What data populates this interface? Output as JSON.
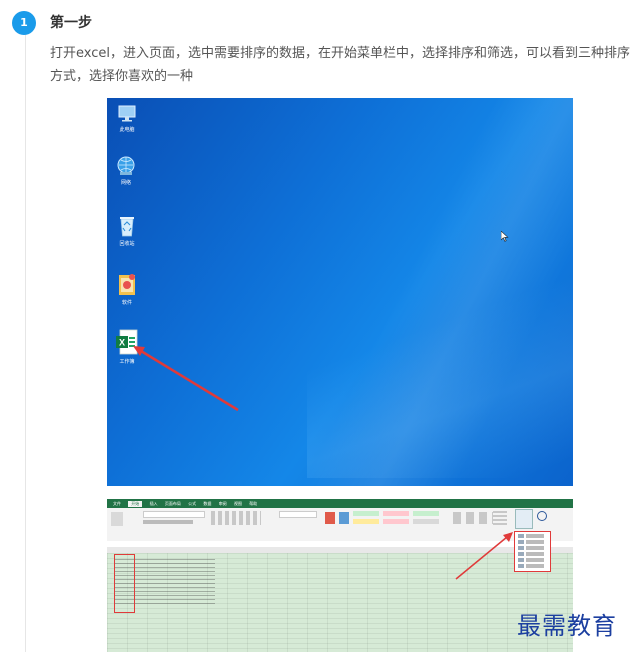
{
  "step": {
    "number": "1",
    "title": "第一步",
    "description": "打开excel，进入页面，选中需要排序的数据，在开始菜单栏中，选择排序和筛选，可以看到三种排序方式，选择你喜欢的一种"
  },
  "desktop": {
    "icons": [
      {
        "name": "this-pc-icon",
        "label": "此电脑"
      },
      {
        "name": "network-icon",
        "label": "网络"
      },
      {
        "name": "recycle-bin-icon",
        "label": "回收站"
      },
      {
        "name": "folder-icon",
        "label": "软件"
      },
      {
        "name": "excel-file-icon",
        "label": "工作簿"
      }
    ]
  },
  "excel": {
    "tabs": [
      "文件",
      "开始",
      "插入",
      "页面布局",
      "公式",
      "数据",
      "审阅",
      "视图",
      "帮助"
    ]
  },
  "watermark": "最需教育",
  "colors": {
    "badge": "#1a9bea",
    "desktop_blue": "#0e6fd6",
    "excel_green": "#217346",
    "arrow_red": "#e03a3a",
    "watermark": "#1c3fa0"
  }
}
